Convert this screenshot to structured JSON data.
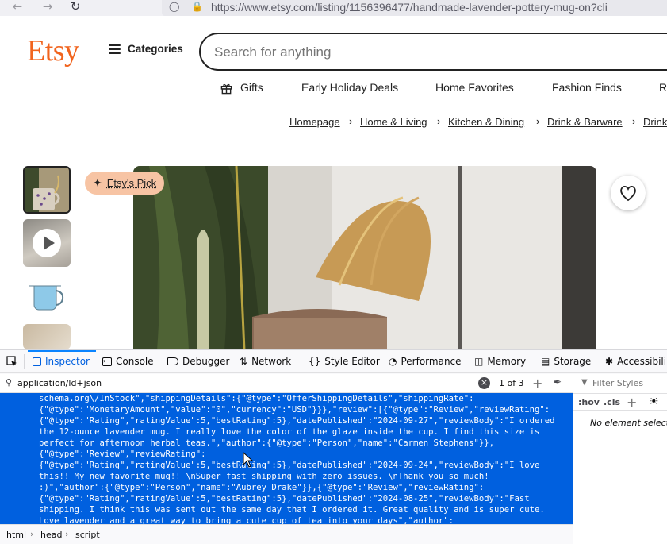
{
  "browser": {
    "back_icon": "arrow-left-icon",
    "forward_icon": "arrow-right-icon",
    "reload_icon": "reload-icon",
    "url": "https://www.etsy.com/listing/1156396477/handmade-lavender-pottery-mug-on?cli"
  },
  "header": {
    "logo": "Etsy",
    "categories_label": "Categories",
    "search_placeholder": "Search for anything",
    "nav": [
      {
        "label": "Gifts"
      },
      {
        "label": "Early Holiday Deals"
      },
      {
        "label": "Home Favorites"
      },
      {
        "label": "Fashion Finds"
      },
      {
        "label": "Re"
      }
    ]
  },
  "breadcrumb": [
    "Homepage",
    "Home & Living",
    "Kitchen & Dining",
    "Drink & Barware",
    "Drink"
  ],
  "listing": {
    "badge": "Etsy's Pick",
    "favorite_icon": "heart-icon"
  },
  "devtools": {
    "tabs": [
      {
        "label": "Inspector",
        "icon": "inspector-icon"
      },
      {
        "label": "Console",
        "icon": "console-icon"
      },
      {
        "label": "Debugger",
        "icon": "debugger-icon"
      },
      {
        "label": "Network",
        "icon": "network-icon"
      },
      {
        "label": "Style Editor",
        "icon": "style-editor-icon"
      },
      {
        "label": "Performance",
        "icon": "performance-icon"
      },
      {
        "label": "Memory",
        "icon": "memory-icon"
      },
      {
        "label": "Storage",
        "icon": "storage-icon"
      },
      {
        "label": "Accessibili",
        "icon": "accessibility-icon"
      }
    ],
    "search_value": "application/ld+json",
    "search_count": "1 of 3",
    "code_lines": [
      "schema.org\\/InStock\",\"shippingDetails\":{\"@type\":\"OfferShippingDetails\",\"shippingRate\":",
      "{\"@type\":\"MonetaryAmount\",\"value\":\"0\",\"currency\":\"USD\"}}},\"review\":[{\"@type\":\"Review\",\"reviewRating\":",
      "{\"@type\":\"Rating\",\"ratingValue\":5,\"bestRating\":5},\"datePublished\":\"2024-09-27\",\"reviewBody\":\"I ordered",
      "the 12-ounce lavender mug. I really love the color of the glaze inside the cup. I find this size is",
      "perfect for afternoon herbal teas.\",\"author\":{\"@type\":\"Person\",\"name\":\"Carmen Stephens\"}},",
      "{\"@type\":\"Review\",\"reviewRating\":",
      "{\"@type\":\"Rating\",\"ratingValue\":5,\"bestRating\":5},\"datePublished\":\"2024-09-24\",\"reviewBody\":\"I love",
      "this!! My new favorite mug!! \\nSuper fast shipping with zero issues. \\nThank you so much!",
      ":)\",\"author\":{\"@type\":\"Person\",\"name\":\"Aubrey Drake\"}},{\"@type\":\"Review\",\"reviewRating\":",
      "{\"@type\":\"Rating\",\"ratingValue\":5,\"bestRating\":5},\"datePublished\":\"2024-08-25\",\"reviewBody\":\"Fast",
      "shipping. I think this was sent out the same day that I ordered it. Great quality and is super cute.",
      "Love lavender and a great way to bring a cute cup of tea into your days\",\"author\":"
    ],
    "dom_breadcrumb": [
      "html",
      "head",
      "script"
    ],
    "filter_placeholder": "Filter Styles",
    "hov_label": ":hov",
    "cls_label": ".cls",
    "no_element": "No element selected."
  },
  "colors": {
    "etsy_orange": "#f1641e",
    "devtools_selection": "#0060df",
    "badge_bg": "#f7c4a4"
  }
}
